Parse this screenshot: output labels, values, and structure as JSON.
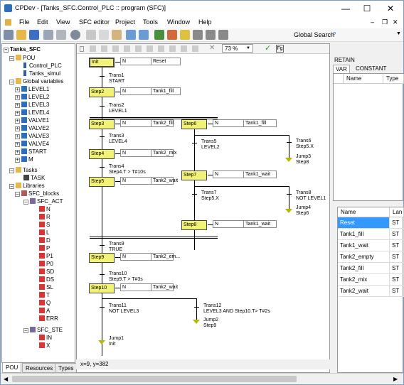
{
  "window": {
    "title": "CPDev - [Tanks_SFC.Control_PLC :: program (SFC)]",
    "minimize": "—",
    "maximize": "☐",
    "close": "✕"
  },
  "menu": [
    "File",
    "Edit",
    "View",
    "SFC editor",
    "Project",
    "Tools",
    "Window",
    "Help"
  ],
  "toolbar": {
    "global_search": "Global Search"
  },
  "sfc_toolbar": {
    "zoom": "73 %"
  },
  "tree": {
    "root": "Tanks_SFC",
    "pou": "POU",
    "pou_items": [
      "Control_PLC",
      "Tanks_simul"
    ],
    "global": "Global variables",
    "globals": [
      "LEVEL1",
      "LEVEL2",
      "LEVEL3",
      "LEVEL4",
      "VALVE1",
      "VALVE2",
      "VALVE3",
      "VALVE4",
      "START",
      "M"
    ],
    "tasks": "Tasks",
    "task_items": [
      "TASK"
    ],
    "libraries": "Libraries",
    "sfc_blocks": "SFC_blocks",
    "sfc_act": "SFC_ACT",
    "act_items": [
      "N",
      "R",
      "S",
      "L",
      "D",
      "P",
      "P1",
      "P0",
      "SD",
      "DS",
      "SL",
      "T",
      "Q",
      "A",
      "ERR"
    ],
    "sfc_step": "SFC_STE",
    "step_items": [
      "IN",
      "X"
    ]
  },
  "bottom_tabs": [
    "POU",
    "Resources",
    "Types"
  ],
  "status": "x=9, y=382",
  "sfc": {
    "steps": {
      "init": "Init",
      "s2": "Step2",
      "s3": "Step3",
      "s4": "Step4",
      "s5": "Step5",
      "s6": "Step6",
      "s7": "Step7",
      "s8": "Step8",
      "s9": "Step9",
      "s10": "Step10"
    },
    "actions": {
      "init": {
        "q": "N",
        "name": "Reset"
      },
      "s2": {
        "q": "N",
        "name": "Tank1_fill"
      },
      "s3": {
        "q": "N",
        "name": "Tank2_fill"
      },
      "s4": {
        "q": "N",
        "name": "Tank2_mix"
      },
      "s5": {
        "q": "N",
        "name": "Tank2_wait"
      },
      "s6": {
        "q": "N",
        "name": "Tank1_fill"
      },
      "s7": {
        "q": "N",
        "name": "Tank1_wait"
      },
      "s8": {
        "q": "N",
        "name": "Tank1_wait"
      },
      "s9": {
        "q": "N",
        "name": "Tank2_em..."
      },
      "s10": {
        "q": "N",
        "name": "Tank2_wait"
      }
    },
    "trans": {
      "t1": [
        "Trans1",
        "START"
      ],
      "t2": [
        "Trans2",
        "LEVEL1"
      ],
      "t3": [
        "Trans3",
        "LEVEL4"
      ],
      "t4": [
        "Trans4",
        "Step4.T > T#10s"
      ],
      "t5": [
        "Trans5",
        "LEVEL2"
      ],
      "t6": [
        "Trans6",
        "Step5.X"
      ],
      "t7": [
        "Trans7",
        "Step5.X"
      ],
      "t8": [
        "Trans8",
        "NOT LEVEL1"
      ],
      "t9": [
        "Trans9",
        "TRUE"
      ],
      "t10": [
        "Trans10",
        "Step9.T > T#3s"
      ],
      "t11": [
        "Trans11",
        "NOT LEVEL3"
      ],
      "t12": [
        "Trans12",
        "LEVEL3 AND Step10.T> T#2s"
      ]
    },
    "jumps": {
      "j1": [
        "Jump1",
        "Init"
      ],
      "j2": [
        "Jump2",
        "Step9"
      ],
      "j3": [
        "Jump3",
        "Step8"
      ],
      "j4": [
        "Jump4",
        "Step6"
      ]
    }
  },
  "right_panel": {
    "tab_retain": "RETAIN",
    "tab_var": "VAR",
    "tab_constant": "CONSTANT",
    "vars_headers": [
      "Name",
      "Type"
    ],
    "actions_headers": [
      "Name",
      "Lan"
    ],
    "actions": [
      {
        "name": "Reset",
        "lang": "ST"
      },
      {
        "name": "Tank1_fill",
        "lang": "ST"
      },
      {
        "name": "Tank1_wait",
        "lang": "ST"
      },
      {
        "name": "Tank2_empty",
        "lang": "ST"
      },
      {
        "name": "Tank2_fill",
        "lang": "ST"
      },
      {
        "name": "Tank2_mix",
        "lang": "ST"
      },
      {
        "name": "Tank2_wait",
        "lang": "ST"
      }
    ]
  },
  "colors": {
    "step": "#f2f277",
    "selected_row": "#3399ff",
    "jump": "#b8b800"
  }
}
